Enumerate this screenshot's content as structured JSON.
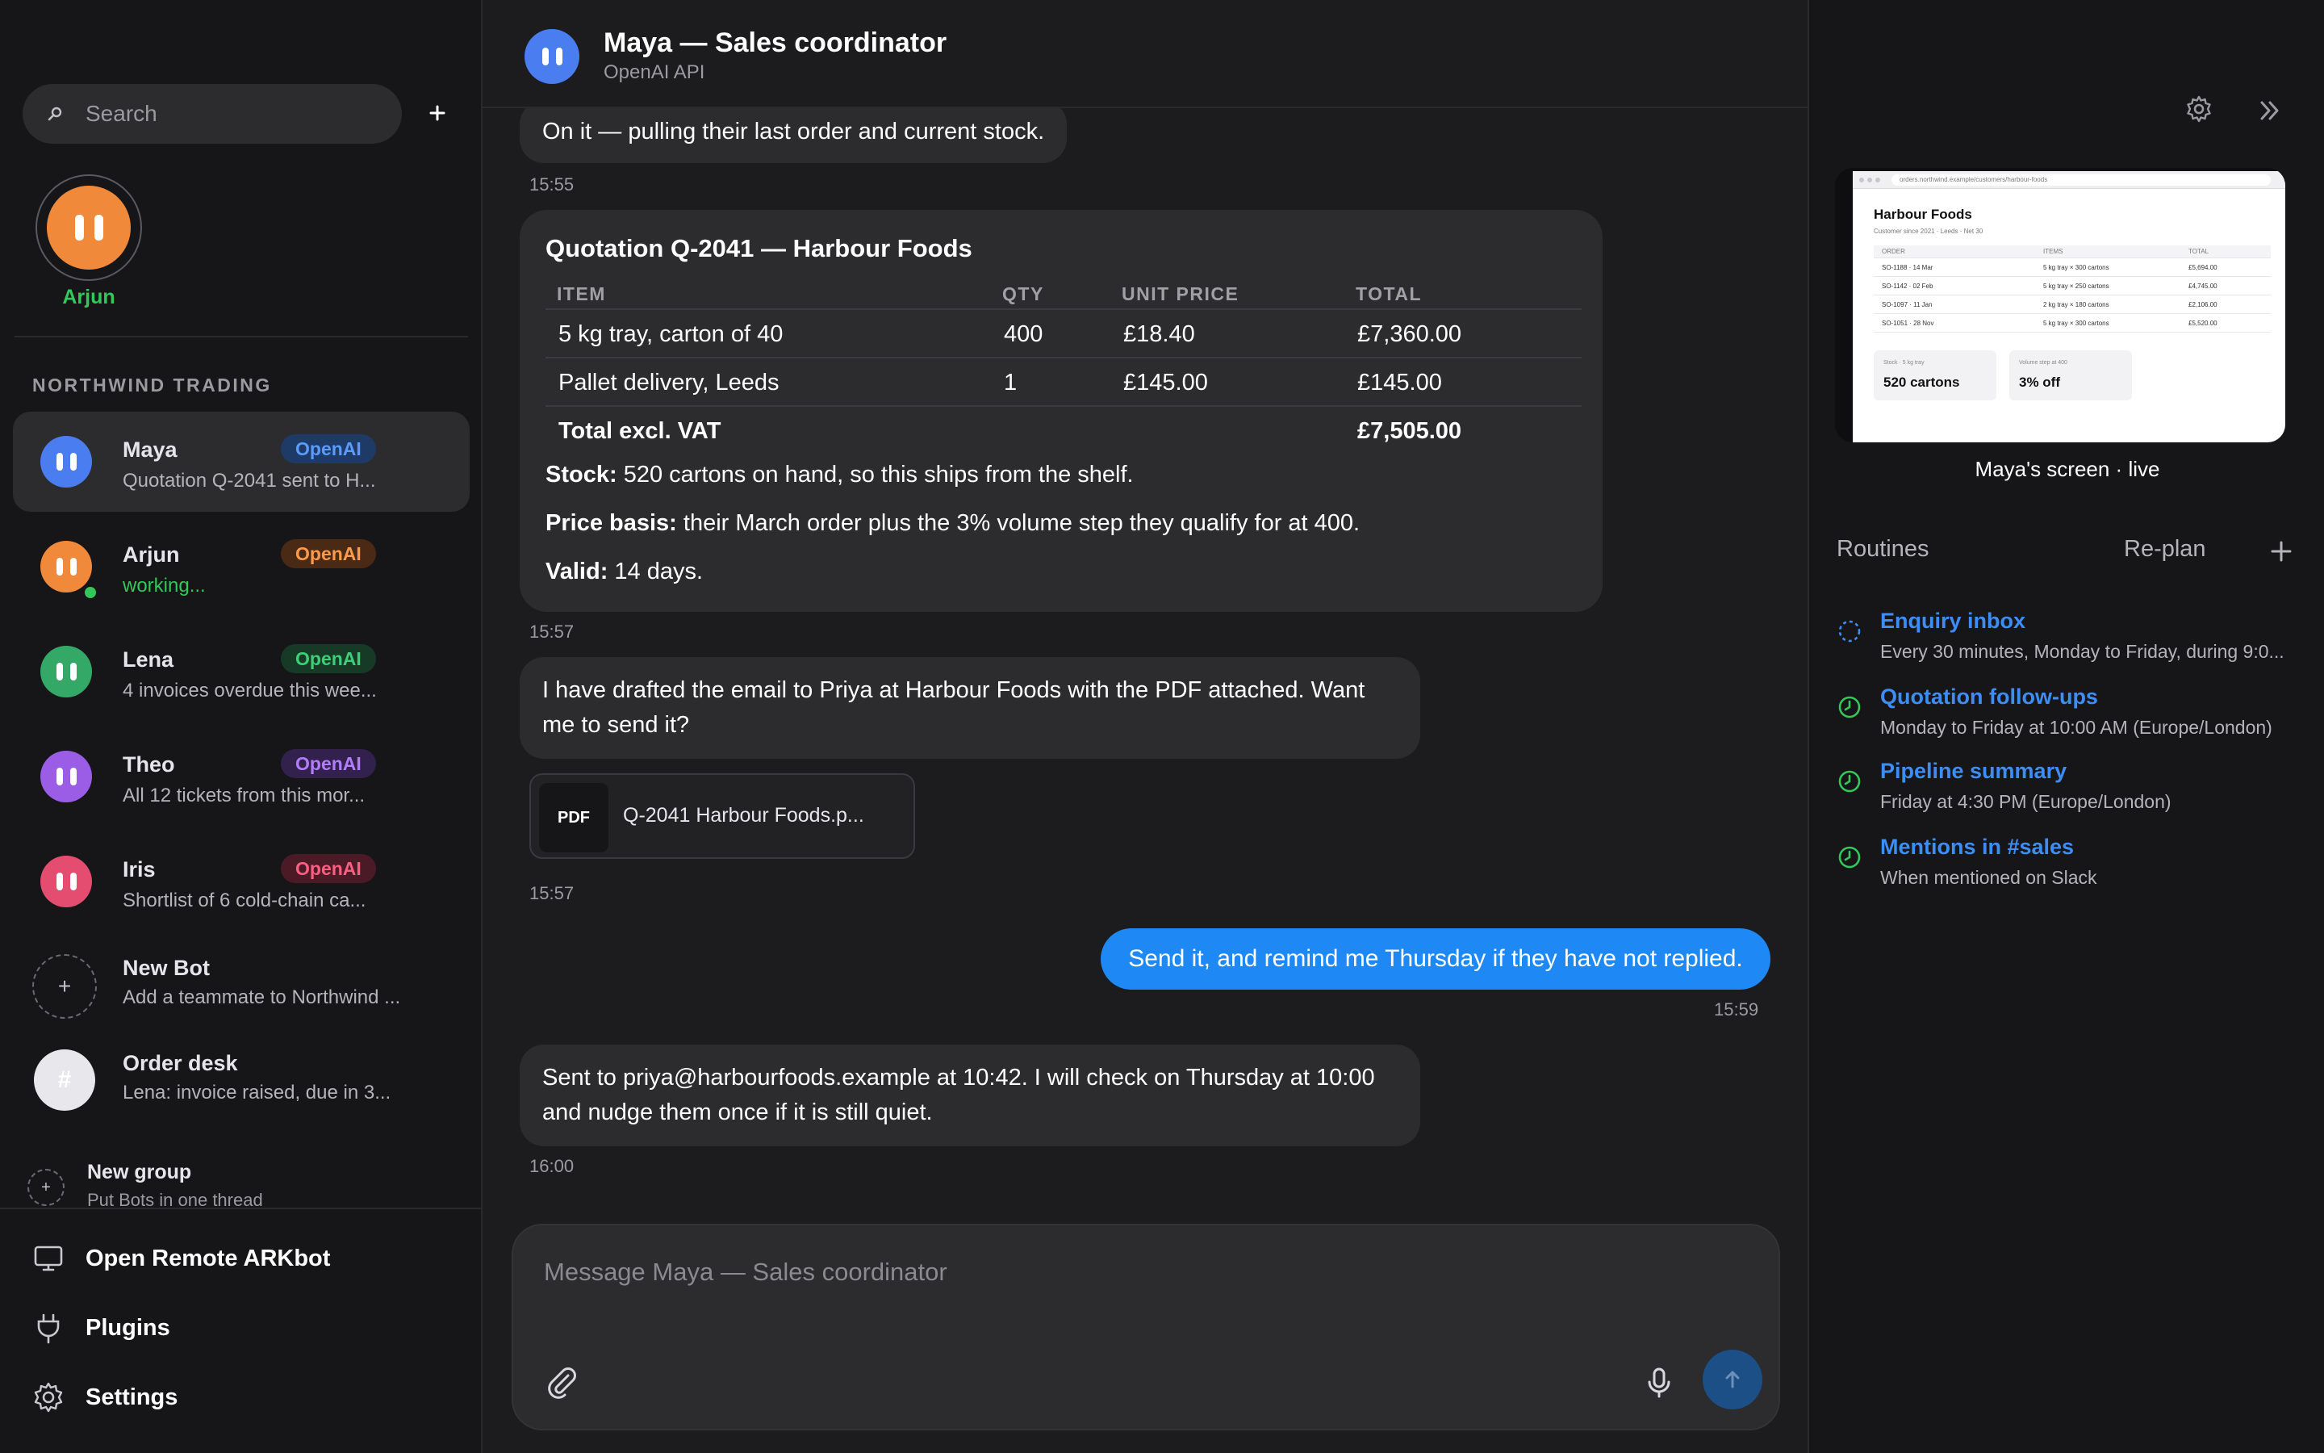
{
  "sidebar": {
    "search_placeholder": "Search",
    "focus_bot": {
      "name": "Arjun"
    },
    "section_title": "NORTHWIND TRADING",
    "bots": [
      {
        "name": "Maya",
        "badge": "OpenAI",
        "subtitle": "Quotation Q-2041 sent to H...",
        "color": "#4a7df0",
        "badge_bg": "#1e3a66",
        "badge_fg": "#5b9bff",
        "active": true
      },
      {
        "name": "Arjun",
        "badge": "OpenAI",
        "subtitle": "working...",
        "color": "#f08a3a",
        "badge_bg": "#4a2a14",
        "badge_fg": "#ff9a4a",
        "working": true
      },
      {
        "name": "Lena",
        "badge": "OpenAI",
        "subtitle": "4 invoices overdue this wee...",
        "color": "#34a867",
        "badge_bg": "#173a26",
        "badge_fg": "#3ccf78"
      },
      {
        "name": "Theo",
        "badge": "OpenAI",
        "subtitle": "All 12 tickets from this mor...",
        "color": "#9b5de5",
        "badge_bg": "#33214d",
        "badge_fg": "#b27cff"
      },
      {
        "name": "Iris",
        "badge": "OpenAI",
        "subtitle": "Shortlist of 6 cold-chain ca...",
        "color": "#e54d70",
        "badge_bg": "#4a1a26",
        "badge_fg": "#ff5e82"
      }
    ],
    "new_bot": {
      "title": "New Bot",
      "subtitle": "Add a teammate to Northwind ..."
    },
    "order_desk": {
      "title": "Order desk",
      "subtitle": "Lena: invoice raised, due in 3..."
    },
    "new_group": {
      "title": "New group",
      "subtitle": "Put Bots in one thread"
    },
    "footer": {
      "remote": "Open Remote ARKbot",
      "plugins": "Plugins",
      "settings": "Settings"
    }
  },
  "chat": {
    "title": "Maya — Sales coordinator",
    "subtitle": "OpenAI API",
    "messages": {
      "m1": "On it — pulling their last order and current stock.",
      "t1": "15:55",
      "t2": "15:57",
      "m3": "I have drafted the email to Priya at Harbour Foods with the PDF attached. Want me to send it?",
      "attachment": {
        "badge": "PDF",
        "name": "Q-2041 Harbour Foods.p..."
      },
      "t3": "15:57",
      "user": "Send it, and remind me Thursday if they have not replied.",
      "t_user": "15:59",
      "m5": "Sent to priya@harbourfoods.example at 10:42. I will check on Thursday at 10:00 and nudge them once if it is still quiet.",
      "t5": "16:00"
    },
    "quotation": {
      "title": "Quotation Q-2041 — Harbour Foods",
      "headers": [
        "ITEM",
        "QTY",
        "UNIT PRICE",
        "TOTAL"
      ],
      "rows": [
        [
          "5 kg tray, carton of 40",
          "400",
          "£18.40",
          "£7,360.00"
        ],
        [
          "Pallet delivery, Leeds",
          "1",
          "£145.00",
          "£145.00"
        ]
      ],
      "total_label": "Total excl. VAT",
      "total_value": "£7,505.00",
      "stock_label": "Stock:",
      "stock_text": " 520 cartons on hand, so this ships from the shelf.",
      "basis_label": "Price basis:",
      "basis_text": " their March order plus the 3% volume step they qualify for at 400.",
      "valid_label": "Valid:",
      "valid_text": " 14 days."
    },
    "composer_placeholder": "Message Maya — Sales coordinator"
  },
  "panel": {
    "preview": {
      "url": "orders.northwind.example/customers/harbour-foods",
      "title": "Harbour Foods",
      "subtitle": "Customer since 2021 · Leeds · Net 30",
      "headers": [
        "ORDER",
        "ITEMS",
        "TOTAL"
      ],
      "rows": [
        [
          "SO-1188 · 14 Mar",
          "5 kg tray × 300 cartons",
          "£5,694.00"
        ],
        [
          "SO-1142 · 02 Feb",
          "5 kg tray × 250 cartons",
          "£4,745.00"
        ],
        [
          "SO-1097 · 11 Jan",
          "2 kg tray × 180 cartons",
          "£2,106.00"
        ],
        [
          "SO-1051 · 28 Nov",
          "5 kg tray × 300 cartons",
          "£5,520.00"
        ]
      ],
      "card1_label": "Stock · 5 kg tray",
      "card1_value": "520 cartons",
      "card2_label": "Volume step at 400",
      "card2_value": "3% off"
    },
    "preview_caption": "Maya's screen · live",
    "routines_title": "Routines",
    "replan": "Re-plan",
    "routines": [
      {
        "name": "Enquiry inbox",
        "schedule": "Every 30 minutes, Monday to Friday, during 9:0...",
        "icon": "running-spinner-icon"
      },
      {
        "name": "Quotation follow-ups",
        "schedule": "Monday to Friday at 10:00 AM (Europe/London)",
        "icon": "clock-icon"
      },
      {
        "name": "Pipeline summary",
        "schedule": "Friday at 4:30 PM (Europe/London)",
        "icon": "clock-icon"
      },
      {
        "name": "Mentions in #sales",
        "schedule": "When mentioned on Slack",
        "icon": "clock-icon"
      }
    ]
  }
}
